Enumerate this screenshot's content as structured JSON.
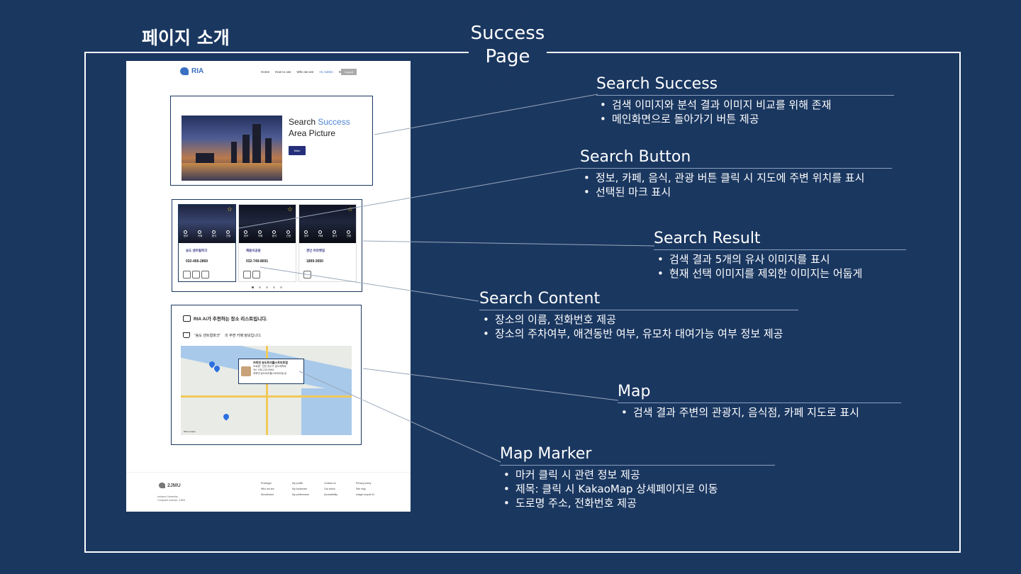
{
  "slide": {
    "title": "페이지 소개",
    "badge_line1": "Success",
    "badge_line2": "Page"
  },
  "mock": {
    "logo": "RIA",
    "nav": [
      "Home",
      "How to use",
      "Who we are",
      "Hi, Admin",
      "My profile"
    ],
    "logout": "Logout",
    "hero": {
      "line1_plain": "Search ",
      "line1_accent": "Success",
      "line2": "Area Picture",
      "main_button": "Main"
    },
    "categories": [
      "정보",
      "카페",
      "음식",
      "관광"
    ],
    "cards": [
      {
        "name": "송도 센트럴파크",
        "phone": "032-456-2860"
      },
      {
        "name": "해돋이공원",
        "phone": "032-749-8691"
      },
      {
        "name": "경인 아라뱃길",
        "phone": "1899-3650"
      }
    ],
    "recommend_title": "RIA Ai가 추천하는 장소 리스트입니다.",
    "recommend_place": "\"송도 센트럴파크\"",
    "recommend_suffix": "의 주변 카페 정보입니다.",
    "popup": {
      "title": "커피빈 송도트리플스트리트점",
      "addr": "도로명 : 인천 연수구 송도과학로",
      "tel": "Tel : 032-210-9944",
      "link": "커피빈 송도트리플스트리트점 상"
    },
    "map_scale": "500m  Kakao",
    "footer": {
      "logo": "2JMU",
      "sub1": "Incheon University",
      "sub2": "Computer science, 2JMU",
      "cols": [
        [
          "Prototype",
          "Who we are",
          "Moodboard"
        ],
        [
          "My profile",
          "My bookmark",
          "My preferences"
        ],
        [
          "Contact us",
          "Our vision",
          "Accessibility"
        ],
        [
          "Privacy policy",
          "Site map",
          "image recycle AI"
        ]
      ]
    }
  },
  "annotations": {
    "search_success": {
      "title": "Search Success",
      "bullets": [
        "검색 이미지와 분석 결과 이미지 비교를 위해 존재",
        "메인화면으로 돌아가기 버튼 제공"
      ]
    },
    "search_button": {
      "title": "Search Button",
      "bullets": [
        "정보, 카페, 음식, 관광 버튼 클릭 시 지도에 주변 위치를 표시",
        "선택된 마크 표시"
      ]
    },
    "search_result": {
      "title": "Search Result",
      "bullets": [
        "검색 결과 5개의 유사 이미지를 표시",
        "현재 선택 이미지를 제외한 이미지는 어둡게"
      ]
    },
    "search_content": {
      "title": "Search Content",
      "bullets": [
        "장소의 이름, 전화번호 제공",
        "장소의 주차여부, 애견동반 여부, 유모차 대여가능 여부 정보 제공"
      ]
    },
    "map": {
      "title": "Map",
      "bullets": [
        "검색 결과 주변의 관광지, 음식점, 카페 지도로 표시"
      ]
    },
    "map_marker": {
      "title": "Map Marker",
      "bullets": [
        "마커 클릭 시 관련 정보 제공",
        "제목: 클릭 시 KakaoMap 상세페이지로 이동",
        "도로명 주소, 전화번호 제공"
      ]
    }
  },
  "colors": {
    "background": "#1a3760",
    "accent": "#4d84d1",
    "button": "#26307a"
  }
}
